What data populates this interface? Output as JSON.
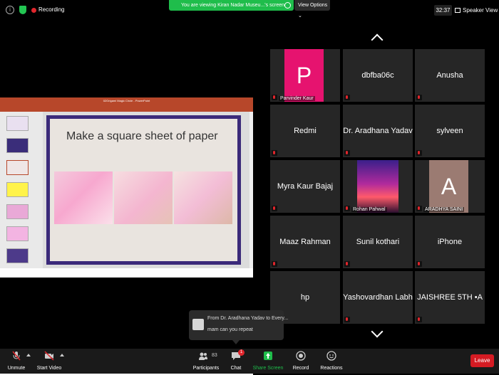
{
  "topbar": {
    "recording_label": "Recording",
    "share_banner": "You are viewing Kiran Nadar Museu...'s screen",
    "view_options": "View Options",
    "timer": "32:37",
    "speaker_view": "Speaker View"
  },
  "slide": {
    "title": "Make a square sheet of paper",
    "window_title": "02Origami Magic Circle - PowerPoint"
  },
  "tiles": [
    {
      "name": "",
      "label": "Parvinder Kaur",
      "avatar": "P",
      "avatar_color": "#e6136f"
    },
    {
      "name": "dbfba06c",
      "label": ""
    },
    {
      "name": "Anusha",
      "label": ""
    },
    {
      "name": "Redmi",
      "label": ""
    },
    {
      "name": "Dr. Aradhana Yadav",
      "label": ""
    },
    {
      "name": "sylveen",
      "label": ""
    },
    {
      "name": "Myra Kaur Bajaj",
      "label": ""
    },
    {
      "name": "",
      "label": "Rohan Pahwal"
    },
    {
      "name": "",
      "label": "ARADHYA SAINI",
      "avatar": "A",
      "avatar_color": "#9b7b72"
    },
    {
      "name": "Maaz Rahman",
      "label": ""
    },
    {
      "name": "Sunil kothari",
      "label": ""
    },
    {
      "name": "iPhone",
      "label": ""
    },
    {
      "name": "hp",
      "label": ""
    },
    {
      "name": "Yashovardhan Labh",
      "label": ""
    },
    {
      "name": "JAISHREE 5TH •A",
      "label": ""
    }
  ],
  "chat_toast": {
    "from": "From Dr. Aradhana Yadav to Every...",
    "message": "mam can you repeat"
  },
  "toolbar": {
    "unmute": "Unmute",
    "start_video": "Start Video",
    "participants": "Participants",
    "participants_count": "83",
    "chat": "Chat",
    "chat_badge": "1",
    "share_screen": "Share Screen",
    "record": "Record",
    "reactions": "Reactions",
    "leave": "Leave"
  },
  "colors": {
    "share_green": "#1fbd4b",
    "leave_red": "#d51b23",
    "tile_bg": "#262626"
  }
}
